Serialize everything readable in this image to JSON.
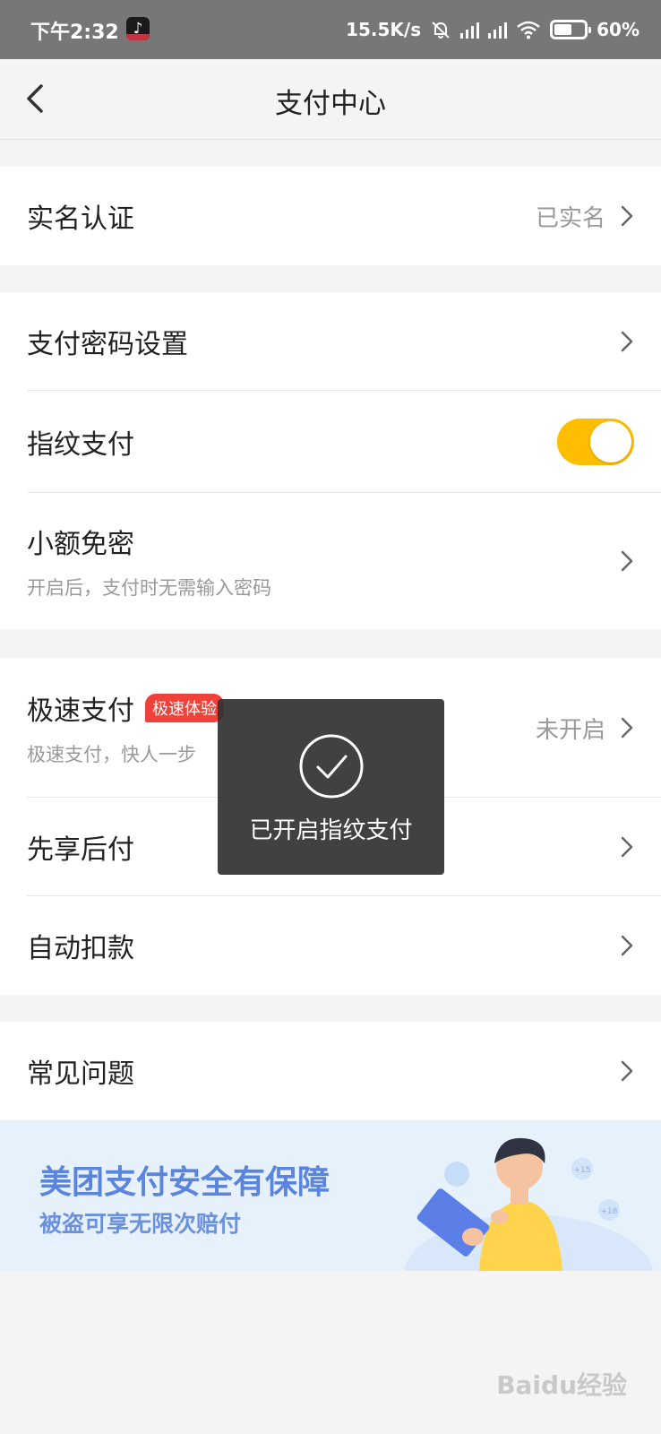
{
  "status_bar": {
    "time": "下午2:32",
    "net_speed": "15.5K/s",
    "battery": "60%",
    "battery_level": 0.6
  },
  "nav": {
    "title": "支付中心"
  },
  "rows": {
    "real_name": {
      "label": "实名认证",
      "value": "已实名"
    },
    "pay_password": {
      "label": "支付密码设置"
    },
    "fingerprint": {
      "label": "指纹支付",
      "enabled": true
    },
    "small_free": {
      "label": "小额免密",
      "sub": "开启后，支付时无需输入密码"
    },
    "fast_pay": {
      "label": "极速支付",
      "badge": "极速体验",
      "sub": "极速支付，快人一步",
      "value": "未开启"
    },
    "pay_later": {
      "label": "先享后付"
    },
    "auto_deduct": {
      "label": "自动扣款"
    },
    "faq": {
      "label": "常见问题"
    }
  },
  "banner": {
    "title": "美团支付安全有保障",
    "subtitle": "被盗可享无限次赔付",
    "bubble_1": "+15",
    "bubble_2": "+18"
  },
  "toast": {
    "text": "已开启指纹支付"
  },
  "watermark": "Baidu经验",
  "colors": {
    "toggle_on": "#ffbd00",
    "badge": "#f0413a",
    "banner_text": "#5b85dd"
  }
}
